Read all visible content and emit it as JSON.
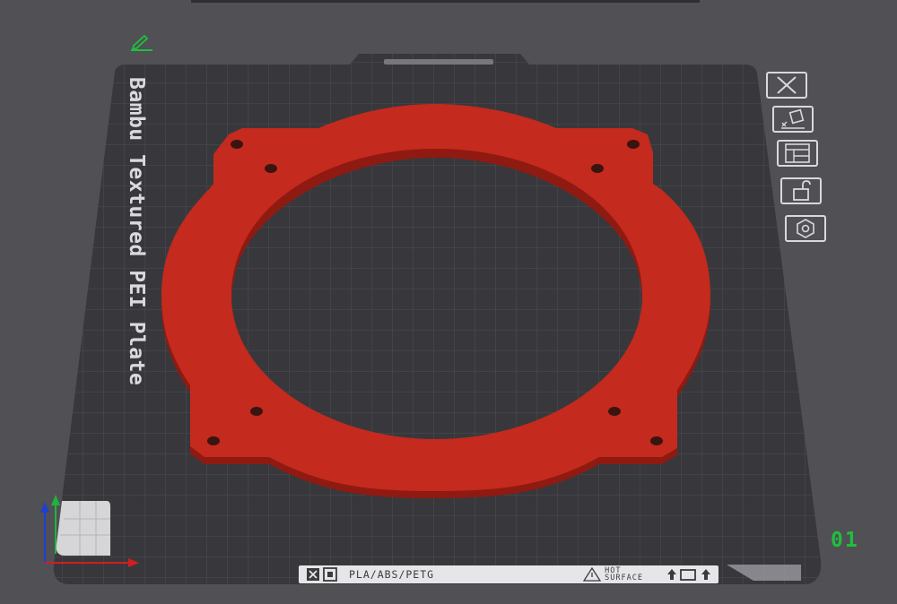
{
  "plate": {
    "name": "Bambu Textured PEI Plate",
    "number": "01"
  },
  "info_bar": {
    "material": "PLA/ABS/PETG",
    "hot_line1": "HOT",
    "hot_line2": "SURFACE"
  },
  "toolbar": {
    "buttons": [
      "close-icon",
      "arrange-icon",
      "layout-icon",
      "lock-icon",
      "settings-icon"
    ]
  },
  "colors": {
    "background": "#505055",
    "plate": "#3a3a3e",
    "grid": "#57575c",
    "model": "#c0281c",
    "model_shadow": "#8f1a12",
    "plate_number": "#1dc13c",
    "edit_icon": "#1dc13c"
  },
  "icons": {
    "edit": "pencil-icon",
    "axis": "axis-gizmo"
  }
}
